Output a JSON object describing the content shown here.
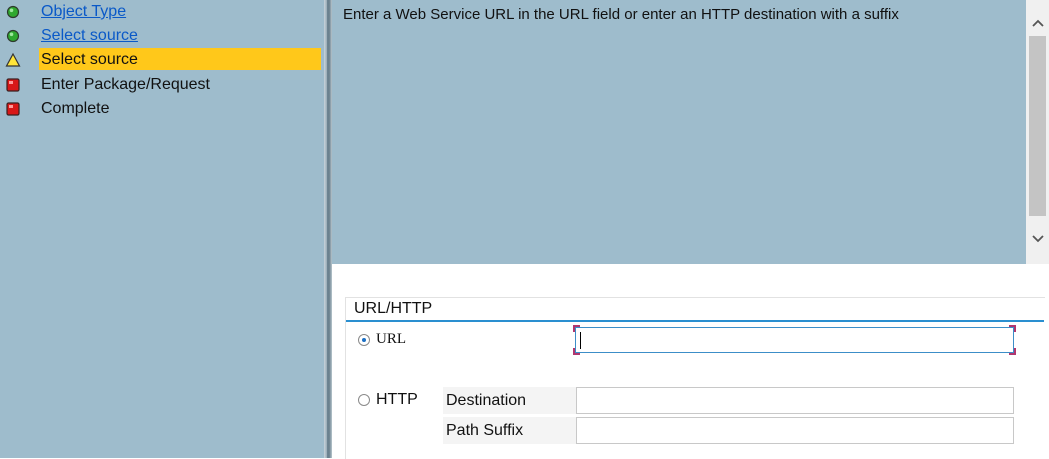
{
  "steps": [
    {
      "label": "Object Type",
      "status": "green-circle-icon",
      "state": "done"
    },
    {
      "label": "Select source",
      "status": "green-circle-icon",
      "state": "done"
    },
    {
      "label": "Select source",
      "status": "yellow-triangle-icon",
      "state": "current"
    },
    {
      "label": "Enter Package/Request",
      "status": "red-square-icon",
      "state": "pending"
    },
    {
      "label": "Complete",
      "status": "red-square-icon",
      "state": "pending"
    }
  ],
  "info": {
    "message": "Enter a Web Service URL in the URL field or enter an HTTP destination with a suffix"
  },
  "group": {
    "title": "URL/HTTP",
    "url_option": {
      "label": "URL",
      "selected": true,
      "value": ""
    },
    "http_option": {
      "label": "HTTP",
      "selected": false
    },
    "destination": {
      "label": "Destination",
      "value": ""
    },
    "path_suffix": {
      "label": "Path Suffix",
      "value": ""
    }
  },
  "colors": {
    "panel_bg": "#9ebccc",
    "highlight": "#ffc81a",
    "link": "#0a59c8",
    "accent": "#2a8fd0"
  }
}
